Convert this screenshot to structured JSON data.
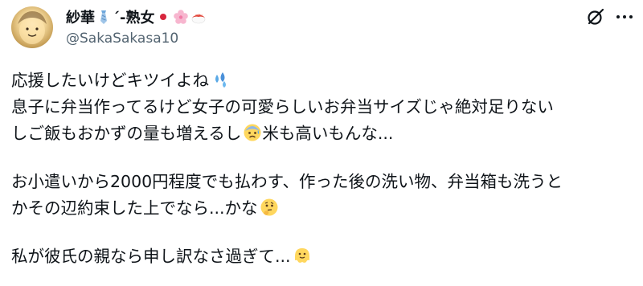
{
  "author": {
    "display_name": "紗華",
    "name_suffix": "´-熟女",
    "handle": "@SakaSakasa10",
    "name_emojis": [
      "tie-emoji",
      "japan-flag-emoji",
      "cherry-blossom-emoji",
      "sushi-emoji"
    ]
  },
  "actions": {
    "grok_icon": "grok-icon",
    "more_icon": "more-icon"
  },
  "post": {
    "line1": "応援したいけどキツイよね",
    "line2": "息子に弁当作ってるけど女子の可愛らしいお弁当サイズじゃ絶対足りない",
    "line3a": "しご飯もおかずの量も増えるし",
    "line3b": "米も高いもんな...",
    "line4": "お小遣いから2000円程度でも払わす、作った後の洗い物、弁当箱も洗うと",
    "line5": "かその辺約束した上でなら...かな",
    "line6": "私が彼氏の親なら申し訳なさ過ぎて...",
    "emojis": [
      "sweat-droplets-emoji",
      "anxious-face-emoji",
      "thinking-face-emoji",
      "melting-face-emoji"
    ]
  },
  "colors": {
    "text": "#0f1419",
    "secondary": "#536471"
  }
}
